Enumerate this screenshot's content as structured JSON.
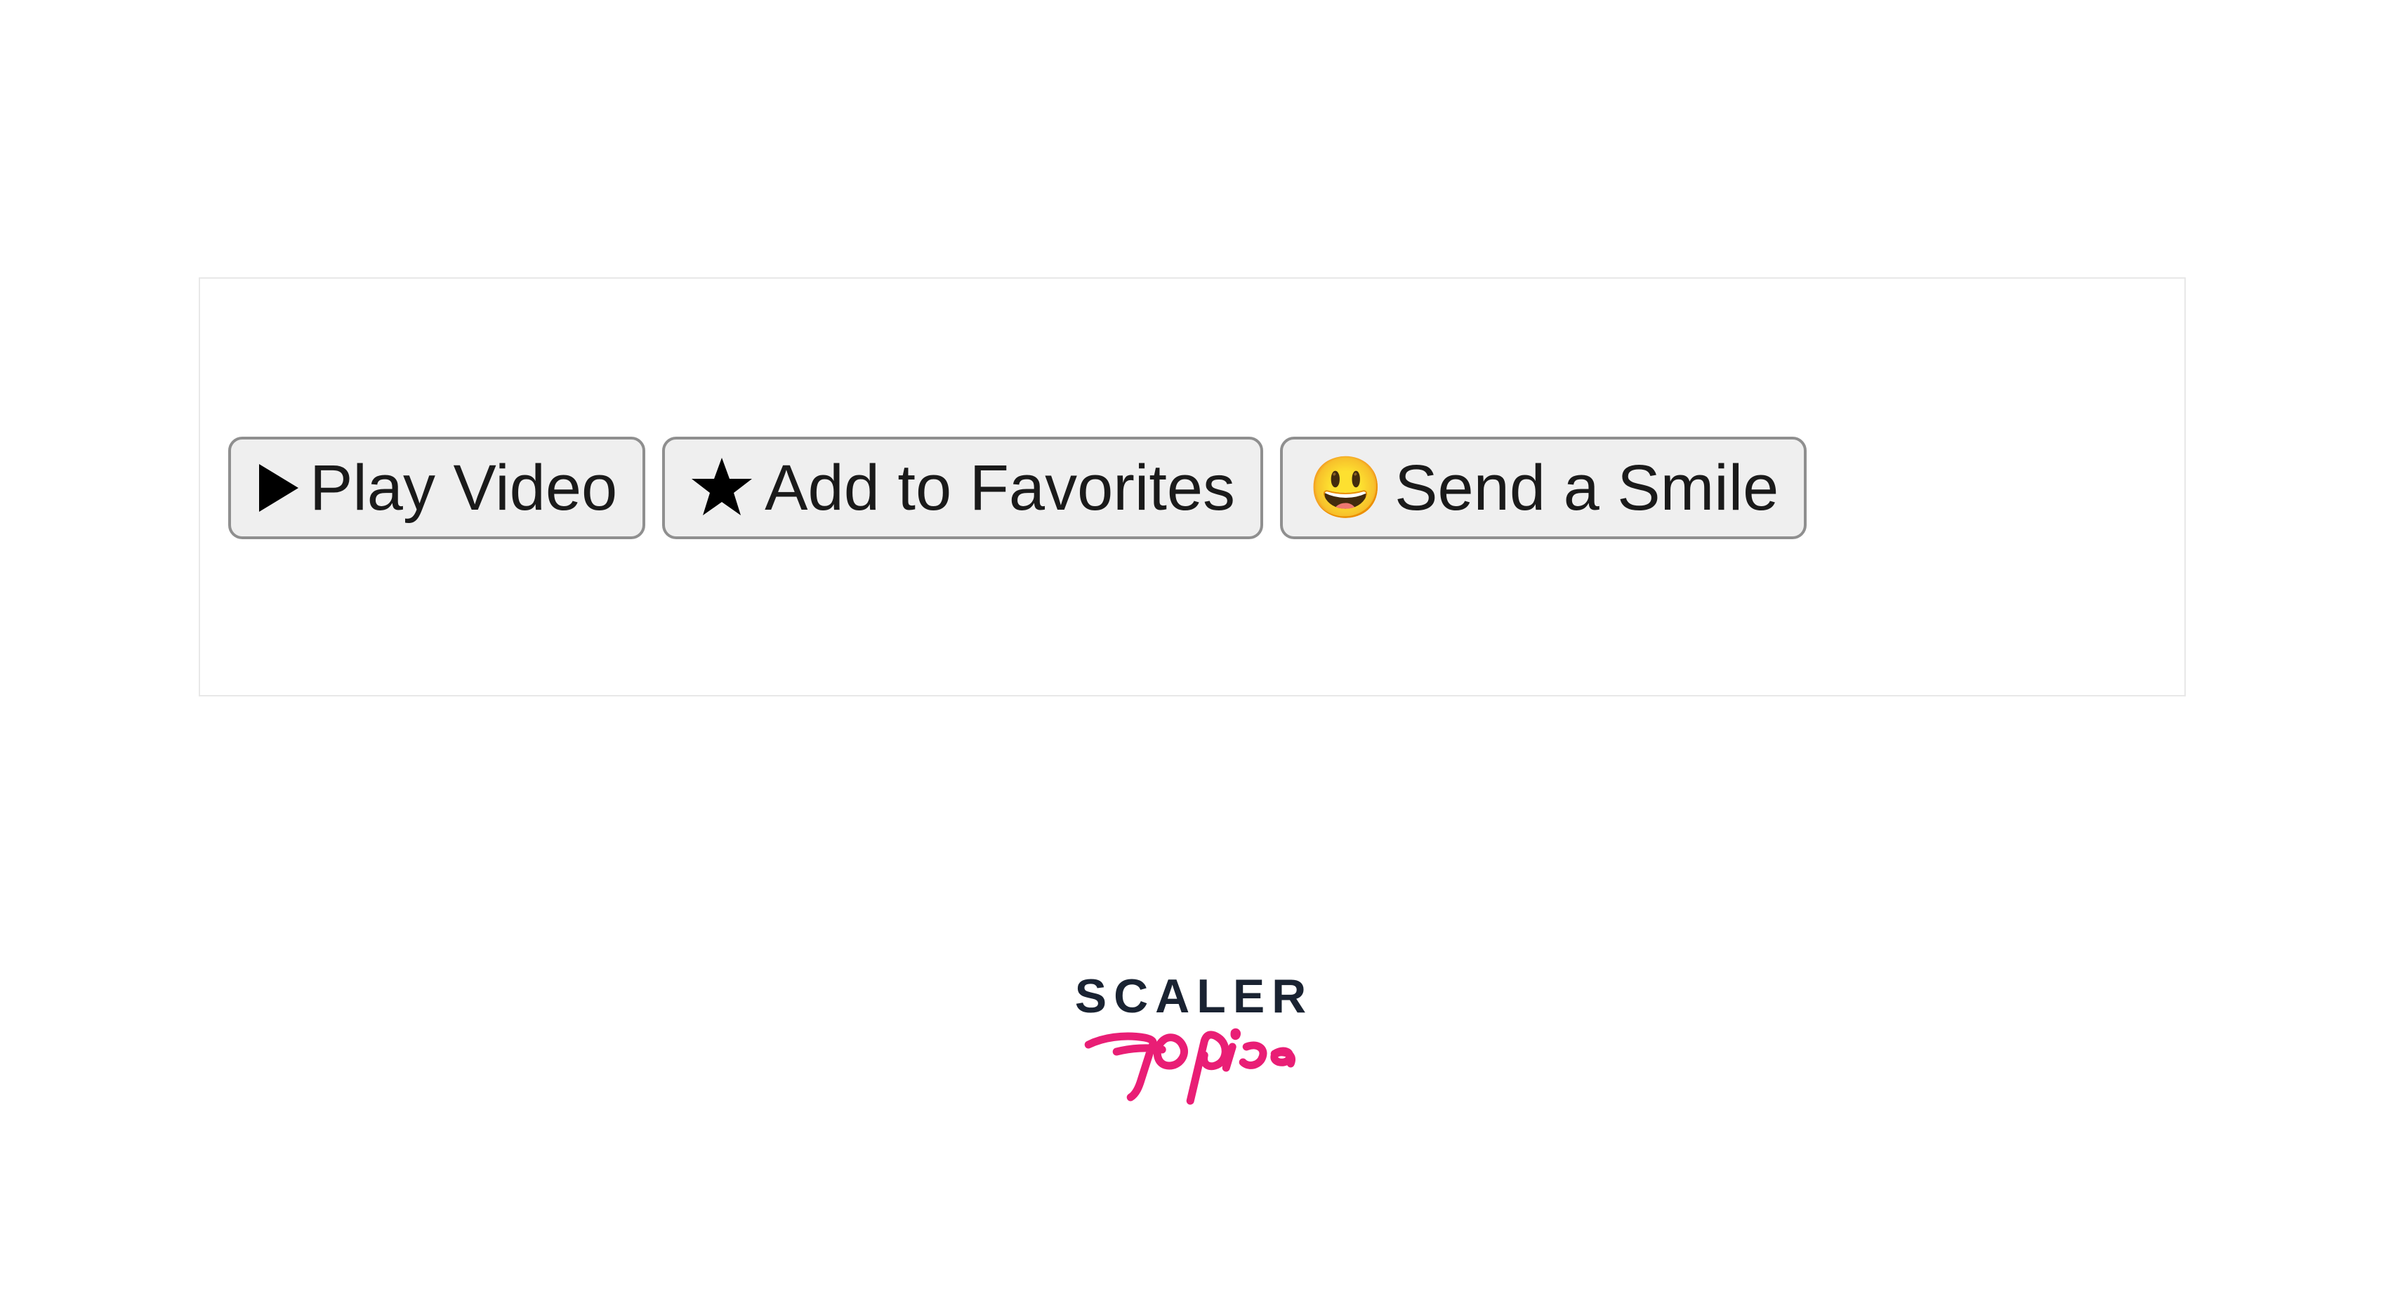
{
  "buttons": {
    "play": {
      "label": "Play Video",
      "icon": "play"
    },
    "favorites": {
      "label": "Add to Favorites",
      "icon": "star"
    },
    "smile": {
      "label": "Send a Smile",
      "icon": "smile",
      "emoji": "😃"
    }
  },
  "logo": {
    "text_top": "SCALER",
    "text_bottom": "Topics"
  }
}
